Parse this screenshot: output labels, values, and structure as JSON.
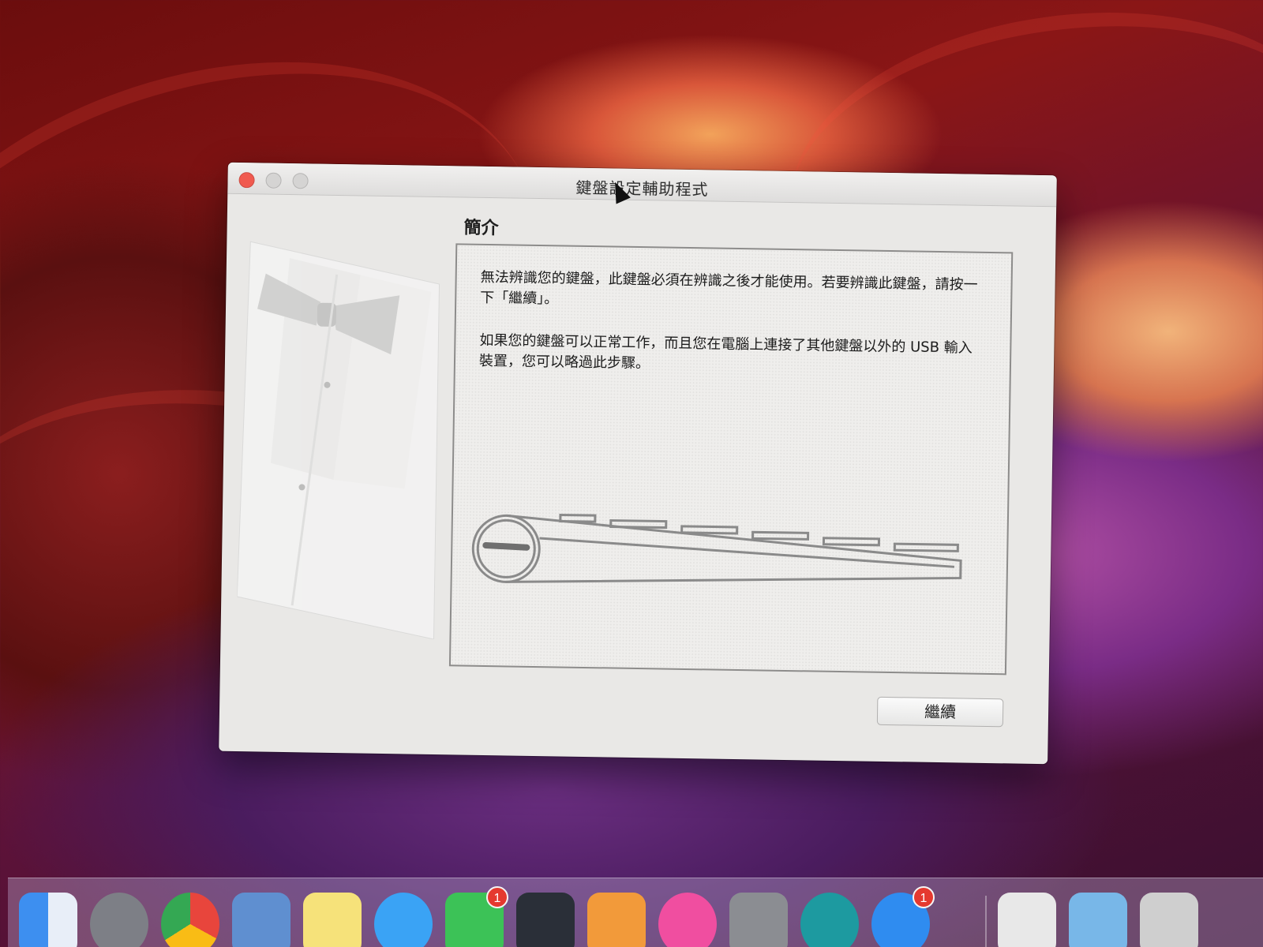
{
  "window": {
    "title": "鍵盤設定輔助程式",
    "section_title": "簡介",
    "paragraph1": "無法辨識您的鍵盤，此鍵盤必須在辨識之後才能使用。若要辨識此鍵盤，請按一下「繼續」。",
    "paragraph2": "如果您的鍵盤可以正常工作，而且您在電腦上連接了其他鍵盤以外的 USB 輸入裝置，您可以略過此步驟。",
    "continue_label": "繼續"
  },
  "dock": {
    "items": [
      {
        "icon": "finder-icon",
        "color": "#3d8ff0"
      },
      {
        "icon": "launchpad-icon",
        "color": "#7d7f86"
      },
      {
        "icon": "chrome-icon",
        "color": "#e8453c"
      },
      {
        "icon": "mail-icon",
        "color": "#5f8fd0"
      },
      {
        "icon": "notes-icon",
        "color": "#f6e27a"
      },
      {
        "icon": "messages-icon",
        "color": "#3aa3f5"
      },
      {
        "icon": "facetime-icon",
        "color": "#3cc257",
        "badge": "1"
      },
      {
        "icon": "numbers-icon",
        "color": "#2a2f38"
      },
      {
        "icon": "pages-icon",
        "color": "#f29a3a"
      },
      {
        "icon": "itunes-icon",
        "color": "#f04ea0"
      },
      {
        "icon": "system-preferences-icon",
        "color": "#8b8d92"
      },
      {
        "icon": "arduino-icon",
        "color": "#1d9aa0"
      },
      {
        "icon": "app-store-icon",
        "color": "#2f8cf0",
        "badge": "1"
      },
      {
        "icon": "document-icon",
        "color": "#e8e8e8"
      },
      {
        "icon": "folder-icon",
        "color": "#78b7e8"
      },
      {
        "icon": "screenshot-icon",
        "color": "#cfcfcf"
      }
    ]
  }
}
